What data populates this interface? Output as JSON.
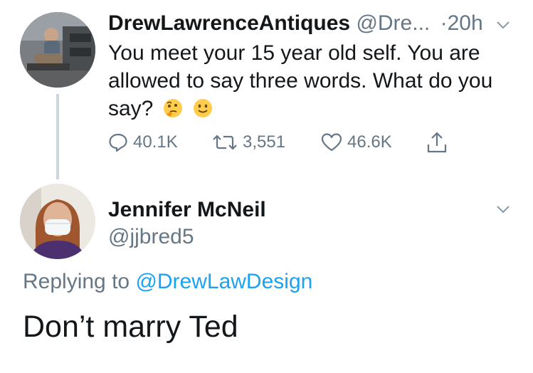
{
  "tweet": {
    "author_name": "DrewLawrenceAntiques",
    "author_handle": "@Dre...",
    "separator": "·",
    "timestamp": "20h",
    "text": "You meet your 15 year old self. You are allowed to say three words. What do you say?",
    "emojis": [
      "thinking-face-emoji",
      "slightly-smiling-face-emoji"
    ],
    "actions": {
      "replies": "40.1K",
      "retweets": "3,551",
      "likes": "46.6K"
    }
  },
  "reply": {
    "author_name": "Jennifer McNeil",
    "author_handle": "@jjbred5",
    "replying_prefix": "Replying to",
    "replying_to": "@DrewLawDesign",
    "text": "Don’t marry Ted"
  },
  "colors": {
    "text": "#14171a",
    "secondary": "#657786",
    "link": "#1da1f2",
    "thread_line": "#ccd6dd"
  },
  "icons": [
    "reply-icon",
    "retweet-icon",
    "like-icon",
    "share-icon",
    "chevron-down-icon"
  ]
}
